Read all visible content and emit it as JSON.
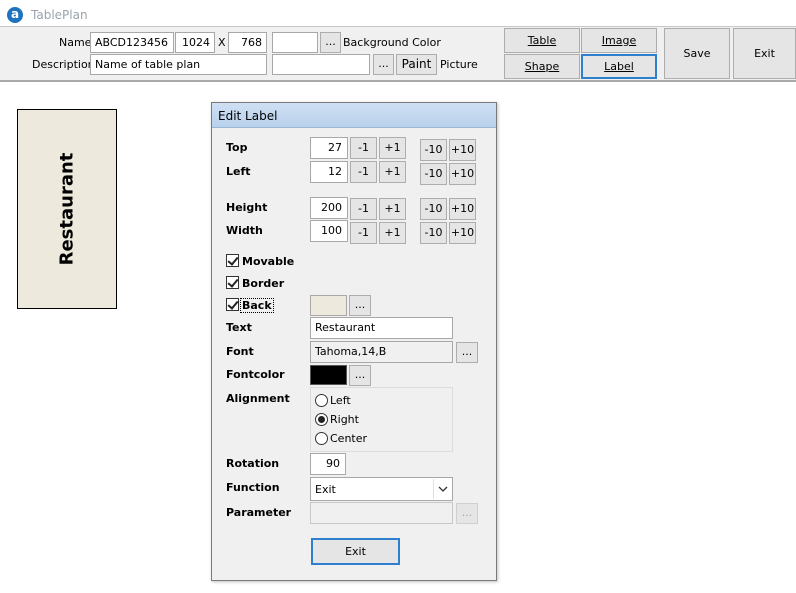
{
  "window": {
    "title": "TablePlan",
    "app_icon": "app-logo-icon"
  },
  "toolbar": {
    "name_label": "Name",
    "name_value": "ABCD123456",
    "width_value": "1024",
    "x_separator": "X",
    "height_value": "768",
    "bg_color_value": "",
    "bg_ellipsis": "...",
    "bg_color_label": "Background Color",
    "description_label": "Description",
    "description_value": "Name of table plan",
    "picture_value": "",
    "picture_ellipsis": "...",
    "paint_label": "Paint",
    "picture_label": "Picture",
    "table_label": "Table",
    "image_label": "Image",
    "shape_label": "Shape",
    "label_label": "Label",
    "save_label": "Save",
    "exit_label": "Exit"
  },
  "canvas": {
    "label_text": "Restaurant",
    "label_bg": "#ede9dc"
  },
  "dialog": {
    "title": "Edit Label",
    "top_label": "Top",
    "top_value": "27",
    "left_label": "Left",
    "left_value": "12",
    "height_label": "Height",
    "height_value": "200",
    "width_label": "Width",
    "width_value": "100",
    "minus1": "-1",
    "plus1": "+1",
    "minus10": "-10",
    "plus10": "+10",
    "movable_label": "Movable",
    "movable_checked": true,
    "border_label": "Border",
    "border_checked": true,
    "back_label": "Back",
    "back_checked": true,
    "back_color": "#ede9dc",
    "ellipsis": "...",
    "text_label": "Text",
    "text_value": "Restaurant",
    "font_label": "Font",
    "font_value": "Tahoma,14,B",
    "fontcolor_label": "Fontcolor",
    "fontcolor": "#000000",
    "alignment_label": "Alignment",
    "align_options": [
      "Left",
      "Right",
      "Center"
    ],
    "align_selected": "Right",
    "rotation_label": "Rotation",
    "rotation_value": "90",
    "function_label": "Function",
    "function_value": "Exit",
    "parameter_label": "Parameter",
    "parameter_value": "",
    "exit_button": "Exit"
  }
}
